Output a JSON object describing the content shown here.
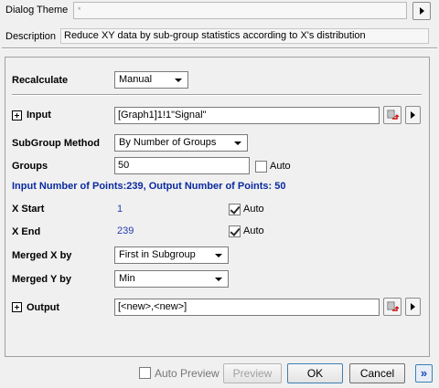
{
  "theme": {
    "label": "Dialog Theme",
    "value": "*"
  },
  "description": {
    "label": "Description",
    "text": "Reduce XY data by sub-group statistics according to X's distribution"
  },
  "recalculate": {
    "label": "Recalculate",
    "value": "Manual"
  },
  "input": {
    "label": "Input",
    "value": "[Graph1]1!1\"Signal\""
  },
  "subgroup": {
    "label": "SubGroup Method",
    "value": "By Number of Groups"
  },
  "groups": {
    "label": "Groups",
    "value": "50",
    "auto_label": "Auto",
    "auto_checked": false
  },
  "points_info": "Input Number of Points:239, Output Number of Points: 50",
  "xstart": {
    "label": "X Start",
    "value": "1",
    "auto_label": "Auto",
    "auto_checked": true
  },
  "xend": {
    "label": "X End",
    "value": "239",
    "auto_label": "Auto",
    "auto_checked": true
  },
  "merged_x": {
    "label": "Merged X by",
    "value": "First in Subgroup"
  },
  "merged_y": {
    "label": "Merged Y by",
    "value": "Min"
  },
  "output": {
    "label": "Output",
    "value": "[<new>,<new>]"
  },
  "footer": {
    "auto_preview_label": "Auto Preview",
    "preview_label": "Preview",
    "ok_label": "OK",
    "cancel_label": "Cancel",
    "expand_symbol": "»"
  }
}
